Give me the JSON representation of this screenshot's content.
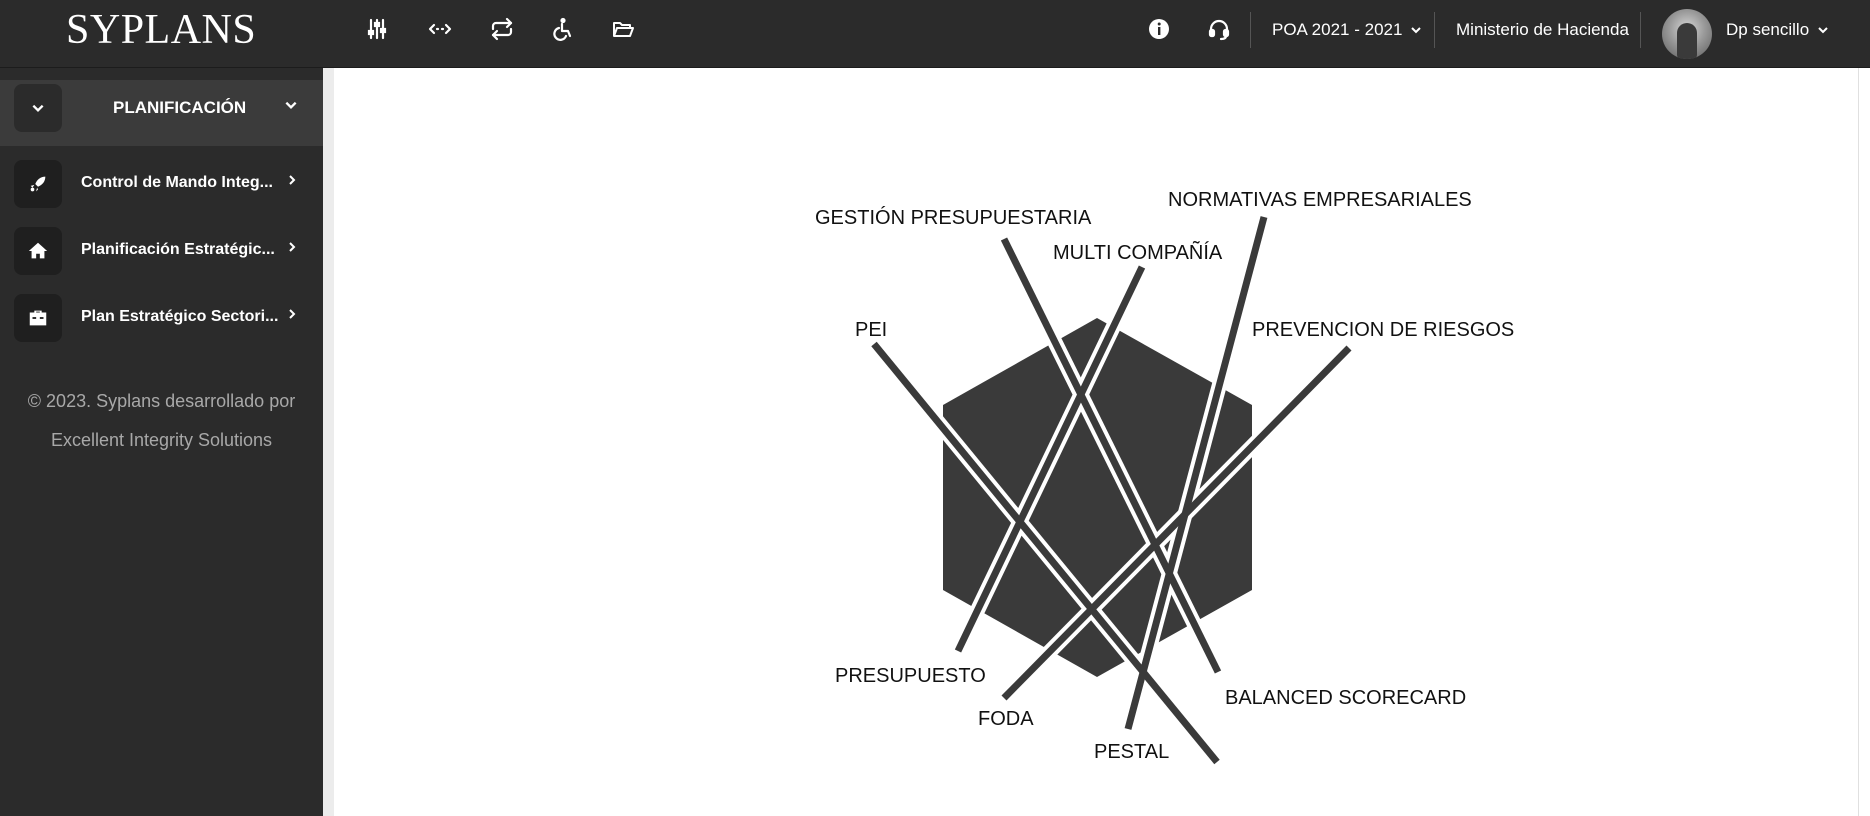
{
  "app": {
    "logo": "SYPLANS"
  },
  "toolbar": {
    "icons": [
      "sliders-icon",
      "arrows-horizontal-icon",
      "repeat-icon",
      "wheelchair-icon",
      "folder-open-icon"
    ]
  },
  "header": {
    "period": "POA 2021 - 2021",
    "ministry": "Ministerio de Hacienda",
    "user": "Dp sencillo"
  },
  "sidebar": {
    "section_title": "PLANIFICACIÓN",
    "items": [
      {
        "label": "Control de Mando Integ...",
        "icon": "rocket-icon"
      },
      {
        "label": "Planificación Estratégic...",
        "icon": "home-icon"
      },
      {
        "label": "Plan Estratégico Sectori...",
        "icon": "briefcase-icon"
      }
    ],
    "footer_line1": "© 2023. Syplans desarrollado por",
    "footer_line2": "Excellent Integrity Solutions"
  },
  "diagram": {
    "labels": {
      "gestion": "GESTIÓN PRESUPUESTARIA",
      "normativas": "NORMATIVAS EMPRESARIALES",
      "multi": "MULTI COMPAÑÍA",
      "pei": "PEI",
      "prevencion": "PREVENCION DE RIESGOS",
      "presupuesto": "PRESUPUESTO",
      "balanced": "BALANCED SCORECARD",
      "foda": "FODA",
      "pestal": "PESTAL"
    },
    "colors": {
      "hexagon": "#3a3a3a",
      "bars": "#3a3a3a"
    }
  }
}
